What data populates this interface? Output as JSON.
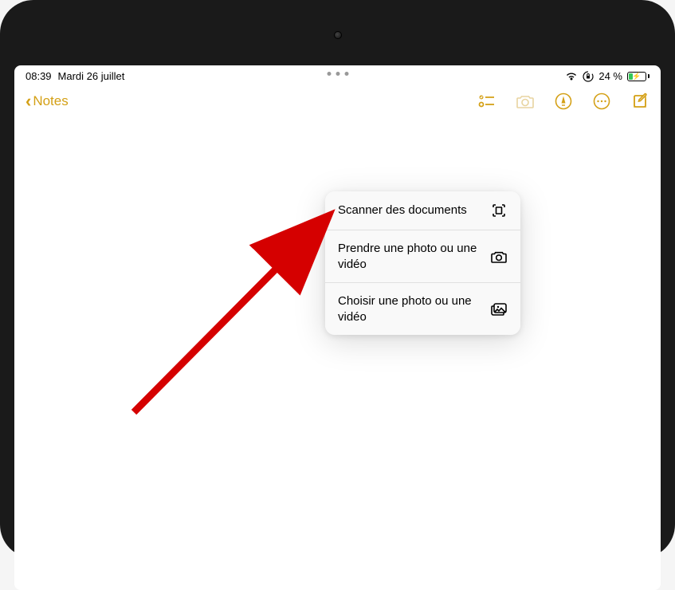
{
  "status": {
    "time": "08:39",
    "date": "Mardi 26 juillet",
    "battery_pct": "24 %"
  },
  "toolbar": {
    "back_label": "Notes"
  },
  "popover": {
    "items": [
      {
        "label": "Scanner des documents",
        "icon": "scan-icon"
      },
      {
        "label": "Prendre une photo ou une vidéo",
        "icon": "camera-icon"
      },
      {
        "label": "Choisir une photo ou une vidéo",
        "icon": "gallery-icon"
      }
    ]
  },
  "colors": {
    "accent": "#d4a016",
    "arrow": "#d50000"
  }
}
